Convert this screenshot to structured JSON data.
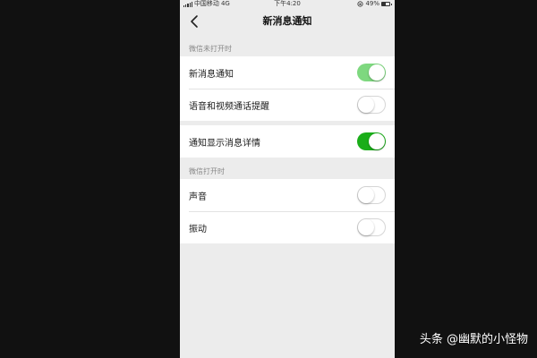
{
  "status_bar": {
    "carrier": "中国移动",
    "network": "4G",
    "time": "下午4:20",
    "battery_text": "49%",
    "battery_level": 0.49
  },
  "nav": {
    "title": "新消息通知"
  },
  "sections": [
    {
      "title": "微信未打开时",
      "items": [
        {
          "label": "新消息通知",
          "on": true,
          "dimmed": true
        },
        {
          "label": "语音和视频通话提醒",
          "on": false
        }
      ]
    },
    {
      "title": "",
      "items": [
        {
          "label": "通知显示消息详情",
          "on": true
        }
      ]
    },
    {
      "title": "微信打开时",
      "items": [
        {
          "label": "声音",
          "on": false
        },
        {
          "label": "振动",
          "on": false
        }
      ]
    }
  ],
  "watermark": "头条 @幽默的小怪物",
  "colors": {
    "toggle_on": "#1aad19",
    "toggle_on_dimmed": "#7ed87f",
    "page_background": "#ececec",
    "outer_background": "#111111"
  }
}
